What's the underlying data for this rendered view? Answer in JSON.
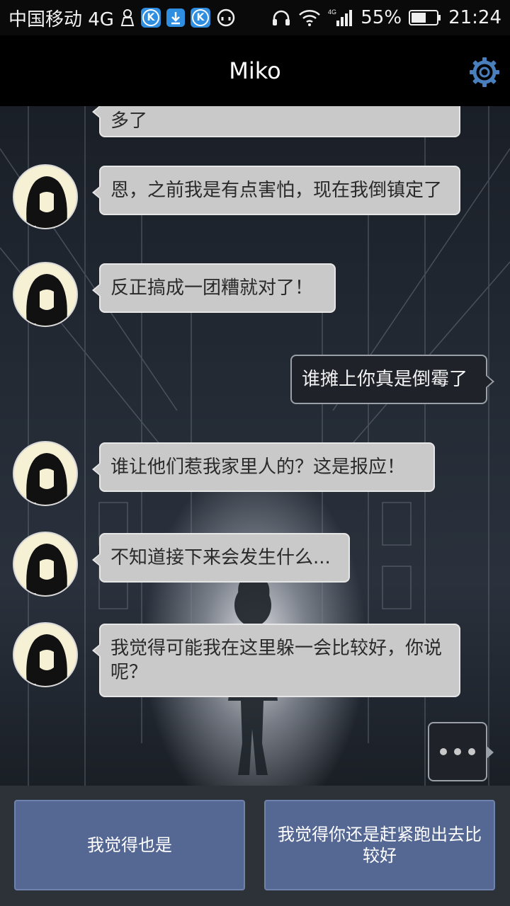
{
  "status_bar": {
    "carrier": "中国移动 4G",
    "network": "4G",
    "battery": "55%",
    "time": "21:24"
  },
  "header": {
    "title": "Miko",
    "settings_icon": "gear-icon"
  },
  "messages": [
    {
      "side": "left",
      "text": "多了"
    },
    {
      "side": "left",
      "text": "恩，之前我是有点害怕，现在我倒镇定了"
    },
    {
      "side": "left",
      "text": "反正搞成一团糟就对了！"
    },
    {
      "side": "right",
      "text": "谁摊上你真是倒霉了"
    },
    {
      "side": "left",
      "text": "谁让他们惹我家里人的？这是报应！"
    },
    {
      "side": "left",
      "text": "不知道接下来会发生什么..."
    },
    {
      "side": "left",
      "text": "我觉得可能我在这里躲一会比较好，你说呢？"
    }
  ],
  "typing_indicator": "···",
  "replies": [
    {
      "label": "我觉得也是"
    },
    {
      "label": "我觉得你还是赶紧跑出去比较好"
    }
  ],
  "colors": {
    "reply_button": "#556894",
    "left_bubble": "#c9c9c9",
    "right_bubble": "#1f2329",
    "title_bar": "#000000"
  }
}
